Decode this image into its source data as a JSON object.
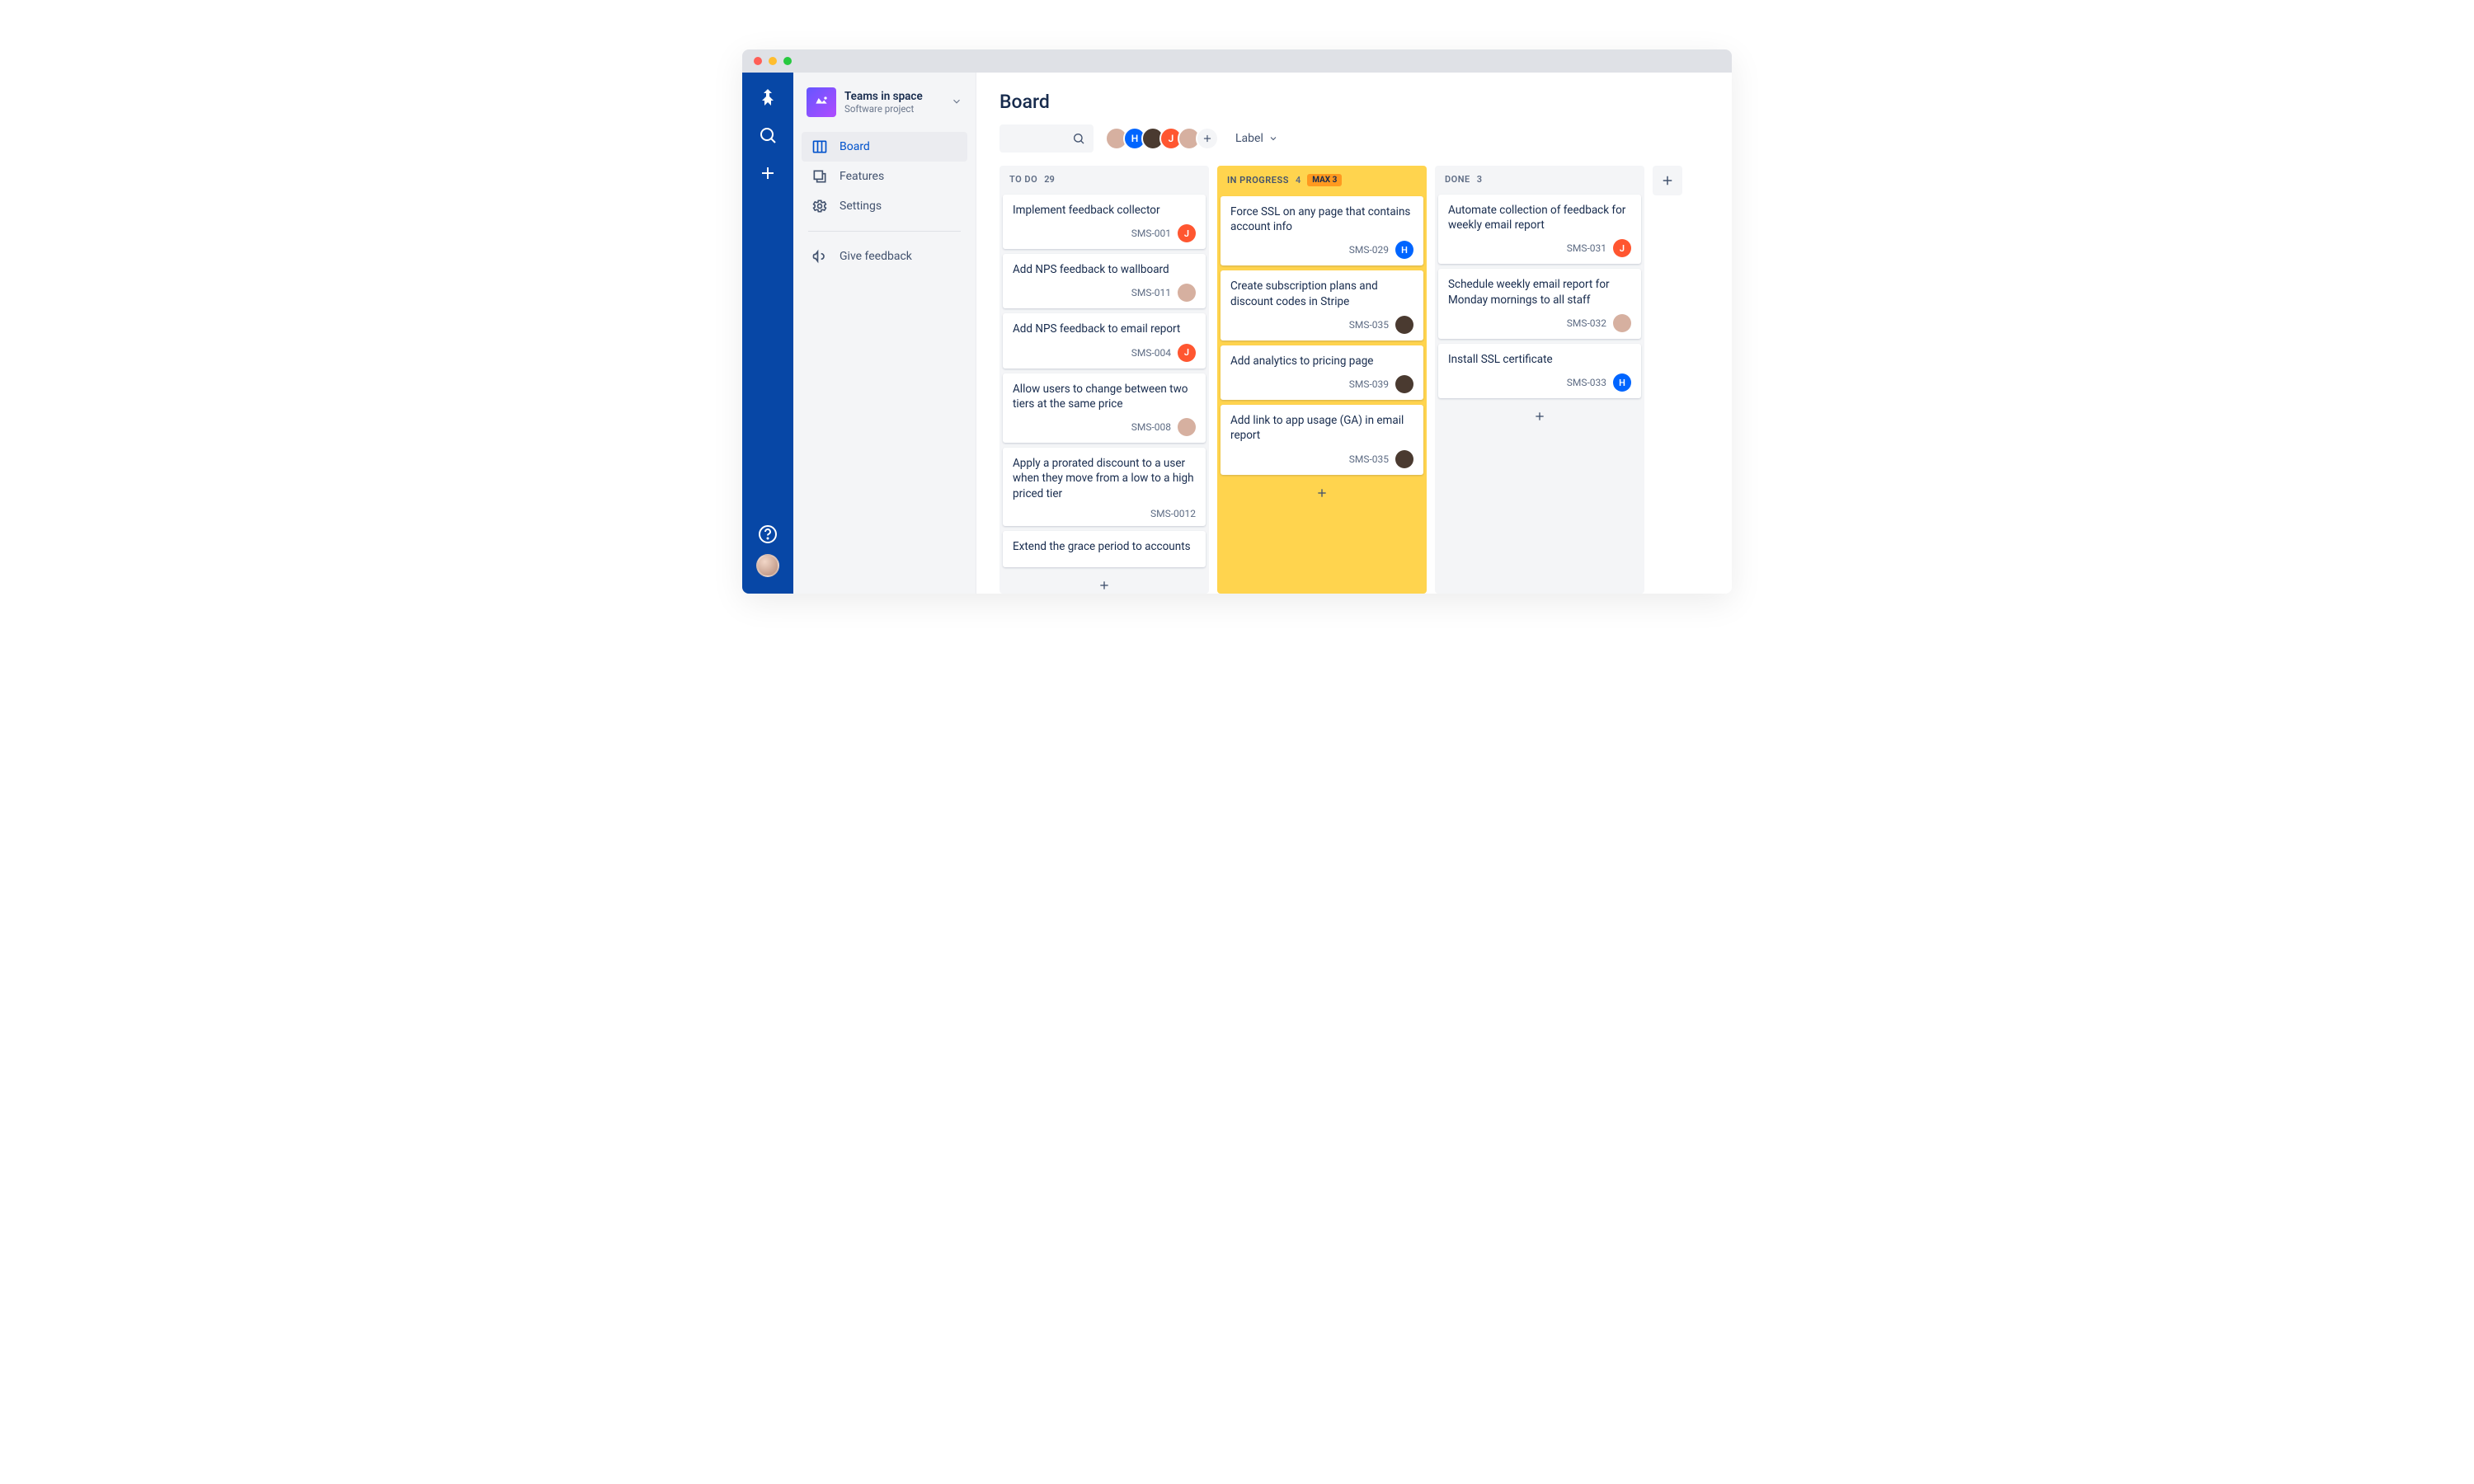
{
  "project": {
    "name": "Teams in space",
    "subtitle": "Software project"
  },
  "nav": {
    "board": "Board",
    "features": "Features",
    "settings": "Settings",
    "feedback": "Give feedback"
  },
  "page": {
    "title": "Board"
  },
  "filter": {
    "label": "Label"
  },
  "avatars": [
    {
      "color": "#d6b0a0",
      "letter": ""
    },
    {
      "color": "#0065FF",
      "letter": "H"
    },
    {
      "color": "#4a3a30",
      "letter": ""
    },
    {
      "color": "#FF5630",
      "letter": "J"
    },
    {
      "color": "#d6b0a0",
      "letter": ""
    }
  ],
  "columns": [
    {
      "title": "TO DO",
      "count": "29",
      "style": "normal",
      "cards": [
        {
          "title": "Implement feedback collector",
          "key": "SMS-001",
          "av": {
            "type": "letter",
            "letter": "J",
            "color": "#FF5630"
          }
        },
        {
          "title": "Add NPS feedback to wallboard",
          "key": "SMS-011",
          "av": {
            "type": "photo",
            "color": "#d6b0a0"
          }
        },
        {
          "title": "Add NPS feedback to email report",
          "key": "SMS-004",
          "av": {
            "type": "letter",
            "letter": "J",
            "color": "#FF5630"
          }
        },
        {
          "title": "Allow users to change between two tiers at the same price",
          "key": "SMS-008",
          "av": {
            "type": "photo",
            "color": "#d6b0a0"
          }
        },
        {
          "title": "Apply a prorated discount to a user when they move from a low to a high priced tier",
          "key": "SMS-0012",
          "av": null
        },
        {
          "title": "Extend the grace period to accounts",
          "key": "",
          "av": null
        }
      ]
    },
    {
      "title": "IN PROGRESS",
      "count": "4",
      "style": "warn",
      "max": "MAX 3",
      "cards": [
        {
          "title": "Force SSL on any page that contains account info",
          "key": "SMS-029",
          "av": {
            "type": "letter",
            "letter": "H",
            "color": "#0065FF"
          }
        },
        {
          "title": "Create subscription plans and discount codes in Stripe",
          "key": "SMS-035",
          "av": {
            "type": "photo2",
            "color": "#4a3a30"
          }
        },
        {
          "title": "Add analytics to pricing page",
          "key": "SMS-039",
          "av": {
            "type": "photo2",
            "color": "#4a3a30"
          }
        },
        {
          "title": "Add link to app usage (GA) in email report",
          "key": "SMS-035",
          "av": {
            "type": "photo2",
            "color": "#4a3a30"
          }
        }
      ]
    },
    {
      "title": "DONE",
      "count": "3",
      "style": "normal",
      "cards": [
        {
          "title": "Automate collection of feedback for weekly email report",
          "key": "SMS-031",
          "av": {
            "type": "letter",
            "letter": "J",
            "color": "#FF5630"
          }
        },
        {
          "title": "Schedule weekly email report for Monday mornings to all staff",
          "key": "SMS-032",
          "av": {
            "type": "photo",
            "color": "#d6b0a0"
          }
        },
        {
          "title": "Install SSL certificate",
          "key": "SMS-033",
          "av": {
            "type": "letter",
            "letter": "H",
            "color": "#0065FF"
          }
        }
      ]
    }
  ]
}
